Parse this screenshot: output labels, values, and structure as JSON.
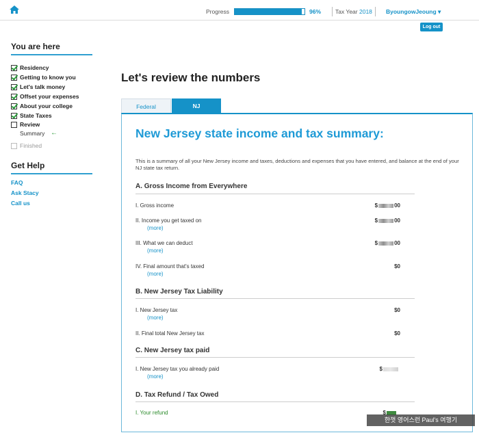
{
  "header": {
    "progress_label": "Progress",
    "progress_fraction": 0.96,
    "progress_text": "96%",
    "tax_year_label": "Tax Year",
    "tax_year": "2018",
    "user_name": "ByoungowJeoung ▾",
    "logout_label": "Log out"
  },
  "sidebar": {
    "you_are_here": "You are here",
    "steps": [
      {
        "label": "Residency",
        "state": "checked"
      },
      {
        "label": "Getting to know you",
        "state": "checked"
      },
      {
        "label": "Let's talk money",
        "state": "checked"
      },
      {
        "label": "Offset your expenses",
        "state": "checked"
      },
      {
        "label": "About your college",
        "state": "checked"
      },
      {
        "label": "State Taxes",
        "state": "checked"
      },
      {
        "label": "Review",
        "state": "unchecked"
      },
      {
        "label": "Finished",
        "state": "disabled"
      }
    ],
    "current_substep": "Summary",
    "get_help": "Get Help",
    "help_links": [
      "FAQ",
      "Ask Stacy",
      "Call us"
    ]
  },
  "main": {
    "page_title": "Let's review the numbers",
    "tabs": [
      "Federal",
      "NJ"
    ],
    "active_tab": "NJ",
    "panel_title": "New Jersey state income and tax summary:",
    "intro": "This is a summary of all your New Jersey income and taxes, deductions and expenses that you have entered, and balance at the end of your NJ state tax return.",
    "more_label": "(more)",
    "sections": [
      {
        "heading": "A. Gross Income from Everywhere",
        "lines": [
          {
            "label": "I. Gross income",
            "prefix": "$",
            "suffix": "00",
            "redacted": true
          },
          {
            "label": "II. Income you get taxed on",
            "prefix": "$",
            "suffix": "00",
            "redacted": true
          },
          {
            "label": "III. What we can deduct",
            "prefix": "$",
            "suffix": "00",
            "redacted": true
          },
          {
            "label": "IV. Final amount that's taxed",
            "amount": "$0"
          }
        ]
      },
      {
        "heading": "B. New Jersey Tax Liability",
        "lines": [
          {
            "label": "I. New Jersey tax",
            "amount": "$0"
          },
          {
            "label": "II. Final total New Jersey tax",
            "amount": "$0"
          }
        ]
      },
      {
        "heading": "C. New Jersey tax paid",
        "lines": [
          {
            "label": "I. New Jersey tax you already paid",
            "prefix": "$",
            "redacted": true
          }
        ]
      },
      {
        "heading": "D. Tax Refund / Tax Owed",
        "lines": [
          {
            "label": "I. Your refund",
            "prefix": "$",
            "redacted": true
          }
        ]
      }
    ]
  },
  "watermark": "한껏 영어스런 Paul's 여행기",
  "colors": {
    "accent": "#1592c8",
    "check_green": "#2a9a3a"
  }
}
